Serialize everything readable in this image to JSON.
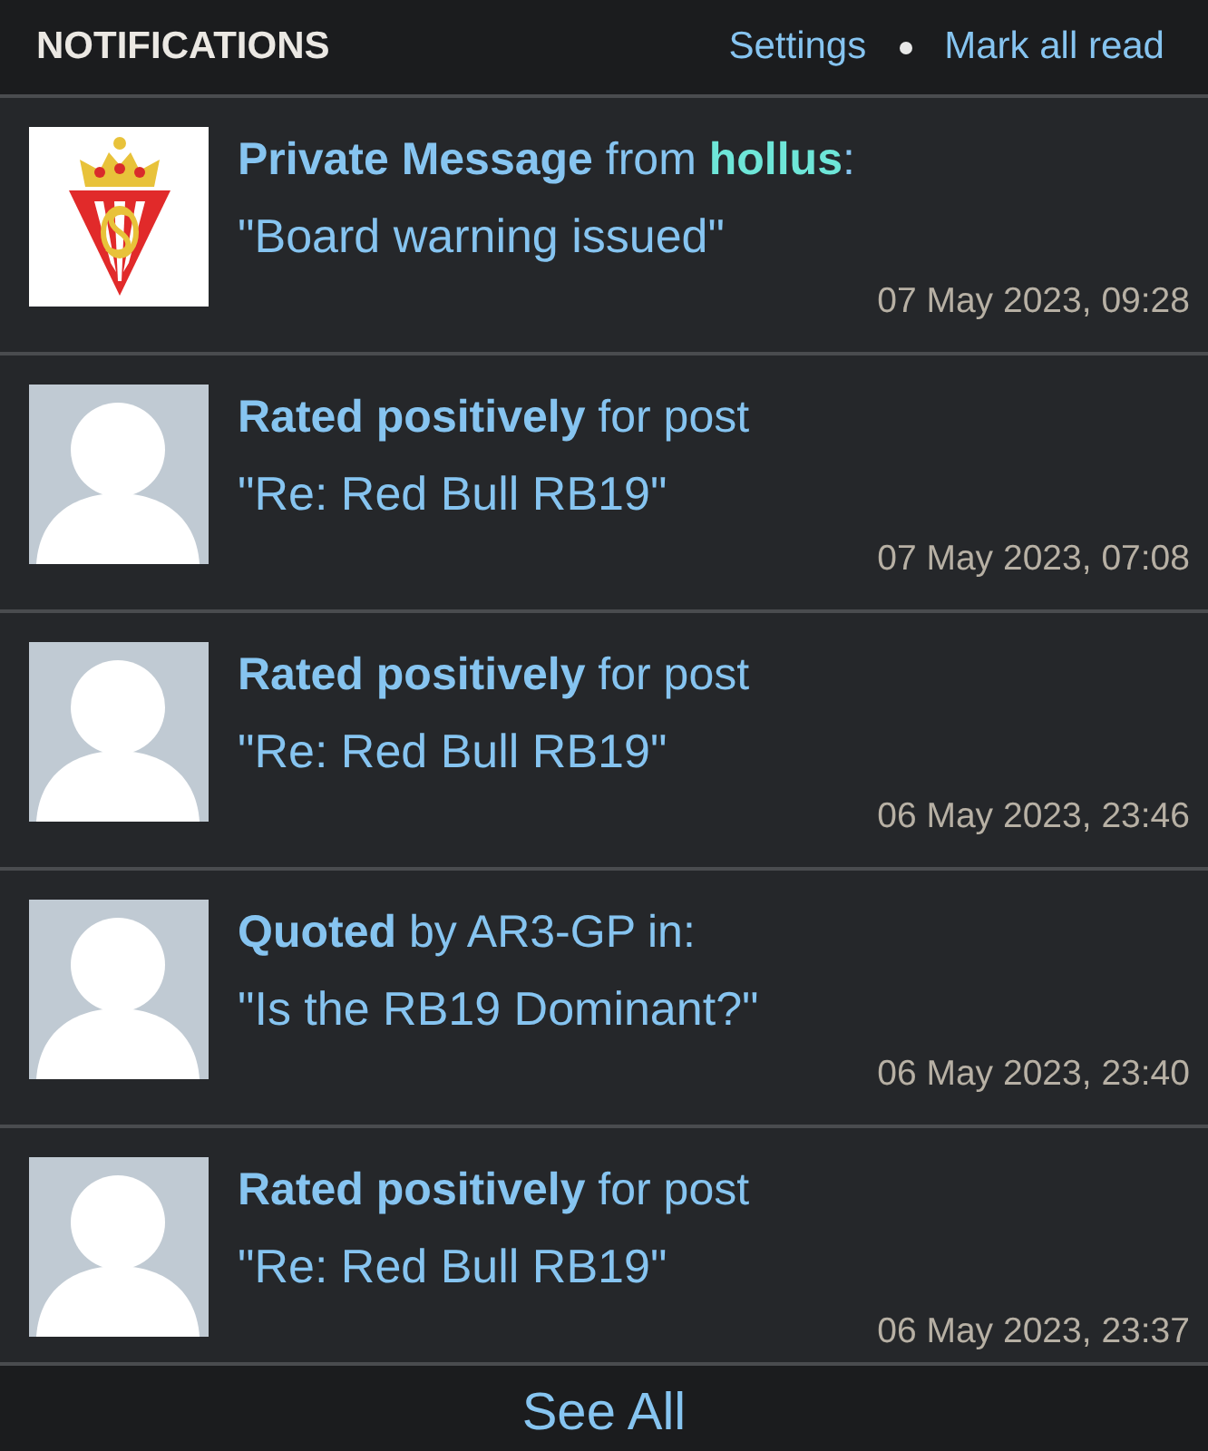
{
  "header": {
    "title": "NOTIFICATIONS",
    "links": [
      "Settings",
      "Mark all read"
    ]
  },
  "notifications": [
    {
      "kind": "crest",
      "title": "**Private Message** from",
      "user": "hollus",
      "title_end": ":",
      "subject": "\"Board warning issued\"",
      "time": "07 May 2023, 09:28"
    },
    {
      "kind": "silhouette",
      "title": "**Rated positively** for post",
      "subject": "\"Re: Red Bull RB19\"",
      "time": "07 May 2023, 07:08"
    },
    {
      "kind": "silhouette",
      "title": "**Rated positively** for post",
      "subject": "\"Re: Red Bull RB19\"",
      "time": "06 May 2023, 23:46"
    },
    {
      "kind": "silhouette",
      "title": "**Quoted** by AR3-GP in:",
      "subject": "\"Is the RB19 Dominant?\"",
      "time": "06 May 2023, 23:40"
    },
    {
      "kind": "silhouette",
      "title": "**Rated positively** for post",
      "subject": "\"Re: Red Bull RB19\"",
      "time": "06 May 2023, 23:37"
    }
  ],
  "footer": {
    "link": "See All"
  }
}
